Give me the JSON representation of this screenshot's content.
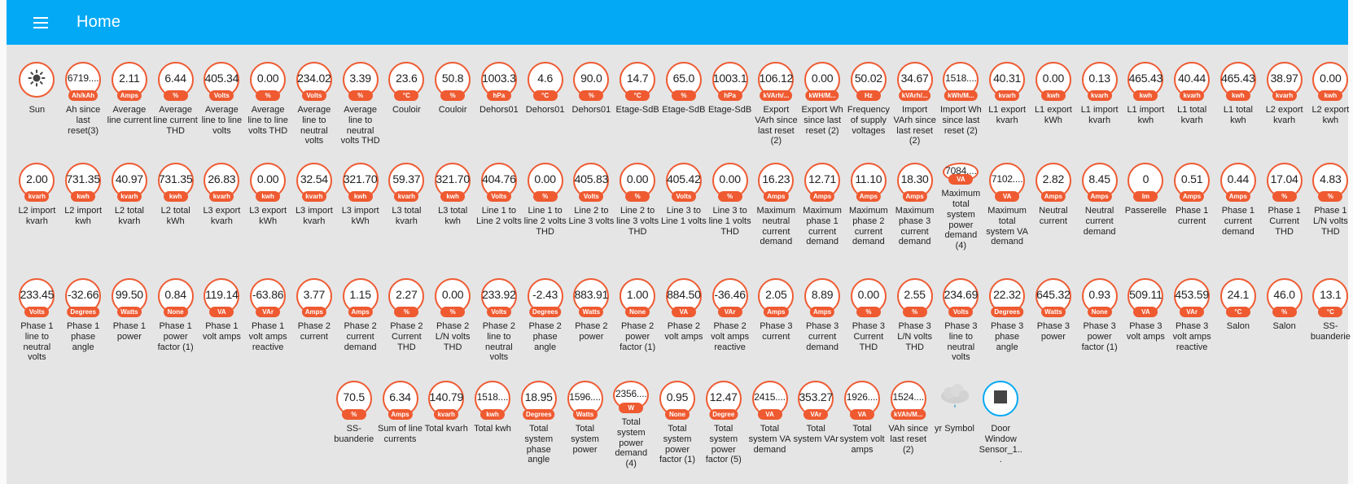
{
  "app": {
    "title": "Home"
  },
  "rows": [
    [
      {
        "value": "",
        "unit": "",
        "label": "Sun",
        "icon": "sun-icon"
      },
      {
        "value": "6719....",
        "unit": "Ah/kAh",
        "label": "Ah since last reset(3)"
      },
      {
        "value": "2.11",
        "unit": "Amps",
        "label": "Average line current"
      },
      {
        "value": "6.44",
        "unit": "%",
        "label": "Average line current THD"
      },
      {
        "value": "405.34",
        "unit": "Volts",
        "label": "Average line to line volts"
      },
      {
        "value": "0.00",
        "unit": "%",
        "label": "Average line to line volts THD"
      },
      {
        "value": "234.02",
        "unit": "Volts",
        "label": "Average line to neutral volts"
      },
      {
        "value": "3.39",
        "unit": "%",
        "label": "Average line to neutral volts THD"
      },
      {
        "value": "23.6",
        "unit": "°C",
        "label": "Couloir"
      },
      {
        "value": "50.8",
        "unit": "%",
        "label": "Couloir"
      },
      {
        "value": "1003.3",
        "unit": "hPa",
        "label": "Dehors01"
      },
      {
        "value": "4.6",
        "unit": "°C",
        "label": "Dehors01"
      },
      {
        "value": "90.0",
        "unit": "%",
        "label": "Dehors01"
      },
      {
        "value": "14.7",
        "unit": "°C",
        "label": "Etage-SdB"
      },
      {
        "value": "65.0",
        "unit": "%",
        "label": "Etage-SdB"
      },
      {
        "value": "1003.1",
        "unit": "hPa",
        "label": "Etage-SdB"
      },
      {
        "value": "106.12",
        "unit": "kVArh/...",
        "label": "Export VArh since last reset (2)"
      },
      {
        "value": "0.00",
        "unit": "kWH/M...",
        "label": "Export Wh since last reset (2)"
      },
      {
        "value": "50.02",
        "unit": "Hz",
        "label": "Frequency of supply voltages"
      },
      {
        "value": "34.67",
        "unit": "kVArh/...",
        "label": "Import VArh since last reset (2)"
      },
      {
        "value": "1518....",
        "unit": "kWh/M...",
        "label": "Import Wh since last reset (2)"
      },
      {
        "value": "40.31",
        "unit": "kvarh",
        "label": "L1 export kvarh"
      },
      {
        "value": "0.00",
        "unit": "kwh",
        "label": "L1 export kWh"
      },
      {
        "value": "0.13",
        "unit": "kvarh",
        "label": "L1 import kvarh"
      },
      {
        "value": "465.43",
        "unit": "kwh",
        "label": "L1 import kwh"
      },
      {
        "value": "40.44",
        "unit": "kvarh",
        "label": "L1 total kvarh"
      },
      {
        "value": "465.43",
        "unit": "kwh",
        "label": "L1 total kwh"
      },
      {
        "value": "38.97",
        "unit": "kvarh",
        "label": "L2 export kvarh"
      },
      {
        "value": "0.00",
        "unit": "kwh",
        "label": "L2 export kwh"
      }
    ],
    [
      {
        "value": "2.00",
        "unit": "kvarh",
        "label": "L2 import kvarh"
      },
      {
        "value": "731.35",
        "unit": "kwh",
        "label": "L2 import kwh"
      },
      {
        "value": "40.97",
        "unit": "kvarh",
        "label": "L2 total kvarh"
      },
      {
        "value": "731.35",
        "unit": "kwh",
        "label": "L2 total kWh"
      },
      {
        "value": "26.83",
        "unit": "kvarh",
        "label": "L3 export kvarh"
      },
      {
        "value": "0.00",
        "unit": "kwh",
        "label": "L3 export kWh"
      },
      {
        "value": "32.54",
        "unit": "kvarh",
        "label": "L3 import kvarh"
      },
      {
        "value": "321.70",
        "unit": "kwh",
        "label": "L3 import kWh"
      },
      {
        "value": "59.37",
        "unit": "kvarh",
        "label": "L3 total kvarh"
      },
      {
        "value": "321.70",
        "unit": "kwh",
        "label": "L3 total kwh"
      },
      {
        "value": "404.76",
        "unit": "Volts",
        "label": "Line 1 to Line 2 volts"
      },
      {
        "value": "0.00",
        "unit": "%",
        "label": "Line 1 to line 2 volts THD"
      },
      {
        "value": "405.83",
        "unit": "Volts",
        "label": "Line 2 to Line 3 volts"
      },
      {
        "value": "0.00",
        "unit": "%",
        "label": "Line 2 to line 3 volts THD"
      },
      {
        "value": "405.42",
        "unit": "Volts",
        "label": "Line 3 to Line 1 volts"
      },
      {
        "value": "0.00",
        "unit": "%",
        "label": "Line 3 to line 1 volts THD"
      },
      {
        "value": "16.23",
        "unit": "Amps",
        "label": "Maximum neutral current demand"
      },
      {
        "value": "12.71",
        "unit": "Amps",
        "label": "Maximum phase 1 current demand"
      },
      {
        "value": "11.10",
        "unit": "Amps",
        "label": "Maximum phase 2 current demand"
      },
      {
        "value": "18.30",
        "unit": "Amps",
        "label": "Maximum phase 3 current demand"
      },
      {
        "value": "7084....",
        "unit": "VA",
        "label": "Maximum total system power demand (4)"
      },
      {
        "value": "7102....",
        "unit": "VA",
        "label": "Maximum total system VA demand"
      },
      {
        "value": "2.82",
        "unit": "Amps",
        "label": "Neutral current"
      },
      {
        "value": "8.45",
        "unit": "Amps",
        "label": "Neutral current demand"
      },
      {
        "value": "0",
        "unit": "lm",
        "label": "Passerelle"
      },
      {
        "value": "0.51",
        "unit": "Amps",
        "label": "Phase 1 current"
      },
      {
        "value": "0.44",
        "unit": "Amps",
        "label": "Phase 1 current demand"
      },
      {
        "value": "17.04",
        "unit": "%",
        "label": "Phase 1 Current THD"
      },
      {
        "value": "4.83",
        "unit": "%",
        "label": "Phase 1 L/N volts THD"
      }
    ],
    [
      {
        "value": "233.45",
        "unit": "Volts",
        "label": "Phase 1 line to neutral volts"
      },
      {
        "value": "-32.66",
        "unit": "Degrees",
        "label": "Phase 1 phase angle"
      },
      {
        "value": "99.50",
        "unit": "Watts",
        "label": "Phase 1 power"
      },
      {
        "value": "0.84",
        "unit": "None",
        "label": "Phase 1 power factor (1)"
      },
      {
        "value": "119.14",
        "unit": "VA",
        "label": "Phase 1 volt amps"
      },
      {
        "value": "-63.86",
        "unit": "VAr",
        "label": "Phase 1 volt amps reactive"
      },
      {
        "value": "3.77",
        "unit": "Amps",
        "label": "Phase 2 current"
      },
      {
        "value": "1.15",
        "unit": "Amps",
        "label": "Phase 2 current demand"
      },
      {
        "value": "2.27",
        "unit": "%",
        "label": "Phase 2 Current THD"
      },
      {
        "value": "0.00",
        "unit": "%",
        "label": "Phase 2 L/N volts THD"
      },
      {
        "value": "233.92",
        "unit": "Volts",
        "label": "Phase 2 line to neutral volts"
      },
      {
        "value": "-2.43",
        "unit": "Degrees",
        "label": "Phase 2 phase angle"
      },
      {
        "value": "883.91",
        "unit": "Watts",
        "label": "Phase 2 power"
      },
      {
        "value": "1.00",
        "unit": "None",
        "label": "Phase 2 power factor (1)"
      },
      {
        "value": "884.50",
        "unit": "VA",
        "label": "Phase 2 volt amps"
      },
      {
        "value": "-36.46",
        "unit": "VAr",
        "label": "Phase 2 volt amps reactive"
      },
      {
        "value": "2.05",
        "unit": "Amps",
        "label": "Phase 3 current"
      },
      {
        "value": "8.89",
        "unit": "Amps",
        "label": "Phase 3 current demand"
      },
      {
        "value": "0.00",
        "unit": "%",
        "label": "Phase 3 Current THD"
      },
      {
        "value": "2.55",
        "unit": "%",
        "label": "Phase 3 L/N volts THD"
      },
      {
        "value": "234.69",
        "unit": "Volts",
        "label": "Phase 3 line to neutral volts"
      },
      {
        "value": "22.32",
        "unit": "Degrees",
        "label": "Phase 3 phase angle"
      },
      {
        "value": "645.32",
        "unit": "Watts",
        "label": "Phase 3 power"
      },
      {
        "value": "0.93",
        "unit": "None",
        "label": "Phase 3 power factor (1)"
      },
      {
        "value": "509.11",
        "unit": "VA",
        "label": "Phase 3 volt amps"
      },
      {
        "value": "453.59",
        "unit": "VAr",
        "label": "Phase 3 volt amps reactive"
      },
      {
        "value": "24.1",
        "unit": "°C",
        "label": "Salon"
      },
      {
        "value": "46.0",
        "unit": "%",
        "label": "Salon"
      },
      {
        "value": "13.1",
        "unit": "°C",
        "label": "SS-buanderie"
      }
    ],
    [
      {
        "value": "70.5",
        "unit": "%",
        "label": "SS-buanderie"
      },
      {
        "value": "6.34",
        "unit": "Amps",
        "label": "Sum of line currents"
      },
      {
        "value": "140.79",
        "unit": "kvarh",
        "label": "Total kvarh"
      },
      {
        "value": "1518....",
        "unit": "kwh",
        "label": "Total kwh"
      },
      {
        "value": "18.95",
        "unit": "Degrees",
        "label": "Total system phase angle"
      },
      {
        "value": "1596....",
        "unit": "Watts",
        "label": "Total system power"
      },
      {
        "value": "2356....",
        "unit": "W",
        "label": "Total system power demand (4)"
      },
      {
        "value": "0.95",
        "unit": "None",
        "label": "Total system power factor (1)"
      },
      {
        "value": "12.47",
        "unit": "Degree",
        "label": "Total system power factor (5)"
      },
      {
        "value": "2415....",
        "unit": "VA",
        "label": "Total system VA demand"
      },
      {
        "value": "353.27",
        "unit": "VAr",
        "label": "Total system VAr"
      },
      {
        "value": "1926....",
        "unit": "VA",
        "label": "Total system volt amps"
      },
      {
        "value": "1524....",
        "unit": "kVAh/M...",
        "label": "VAh since last reset (2)"
      },
      {
        "value": "",
        "unit": "",
        "label": "yr Symbol",
        "icon": "cloud-rain-icon"
      },
      {
        "value": "",
        "unit": "",
        "label": "Door Window Sensor_1...",
        "icon": "stop-icon",
        "blue": true
      }
    ]
  ],
  "colors": {
    "accent": "#03a9f4",
    "badge": "#ef5a31",
    "background": "#e5e5e5"
  }
}
